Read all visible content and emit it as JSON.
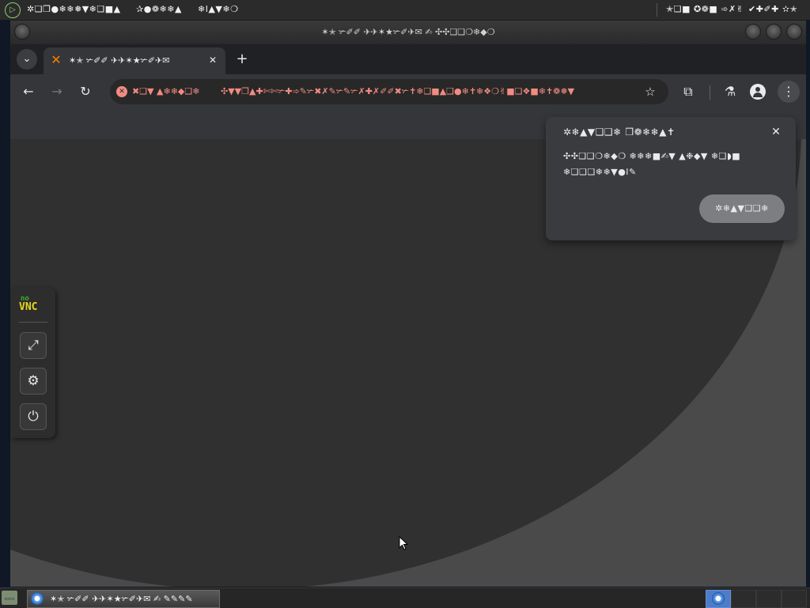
{
  "topbar": {
    "menu_left_1": "✲❑❒●❄❄❅▼❄❑■▲",
    "menu_left_2": "✰●❁❄❄▲",
    "menu_left_3": "❄I▲▼❄❍",
    "menu_right_1": "✭❑■ ✪❁■ ➾✗✌",
    "menu_right_2": "✔✚✐✚ ✫✭"
  },
  "window": {
    "title": "✶✭ ✃✐✐ ✈✈✶★✃✐✈✉ ✍ ✣✣❑❏❍❄◆❍"
  },
  "tabs": [
    {
      "label": "✶✭ ✃✐✐ ✈✈✶★✃✐✈✉"
    }
  ],
  "toolbar": {
    "warning_text": "✖❑▼ ▲❄❄◆❑❄",
    "url": "✣▼▼❐▲✚✄✄✃✚➾✎✃✖✗✎✃✎✃✗✚✗✐✐✖✃✝❄❑■▲❑●❄✝❄❖❍✌■❑❖■❄✝❁❅▼",
    "icons": {
      "back": "arrow-left-icon",
      "forward": "arrow-right-icon",
      "reload": "reload-icon",
      "star": "star-icon",
      "extensions": "puzzle-icon",
      "labs": "flask-icon",
      "profile": "profile-icon",
      "menu": "kebab-icon"
    }
  },
  "popup": {
    "title": "✲❄▲▼❑❑❄ ❒❁❄❄▲✝",
    "body": "✣✣❑❑❍❄◆❍ ❄❄❄■✍▼ ▲❉◆▼ ❄❑◗■ ❄❑❑❑❄❄▼●I✎",
    "button_label": "✲❄▲▼❑❑❄"
  },
  "novnc": {
    "logo_no": "no",
    "logo_vnc": "VNC"
  },
  "taskbar": {
    "launcher_label": "▭▭",
    "window_label": "✶✭ ✃✐✐ ✈✈✶★✃✐✈✉ ✍ ✎✎✎✎"
  },
  "colors": {
    "accent_warning": "#f28b82",
    "tab_favicon": "#ff7a00",
    "novnc_green": "#3fae2a",
    "novnc_yellow": "#e6d91e"
  }
}
